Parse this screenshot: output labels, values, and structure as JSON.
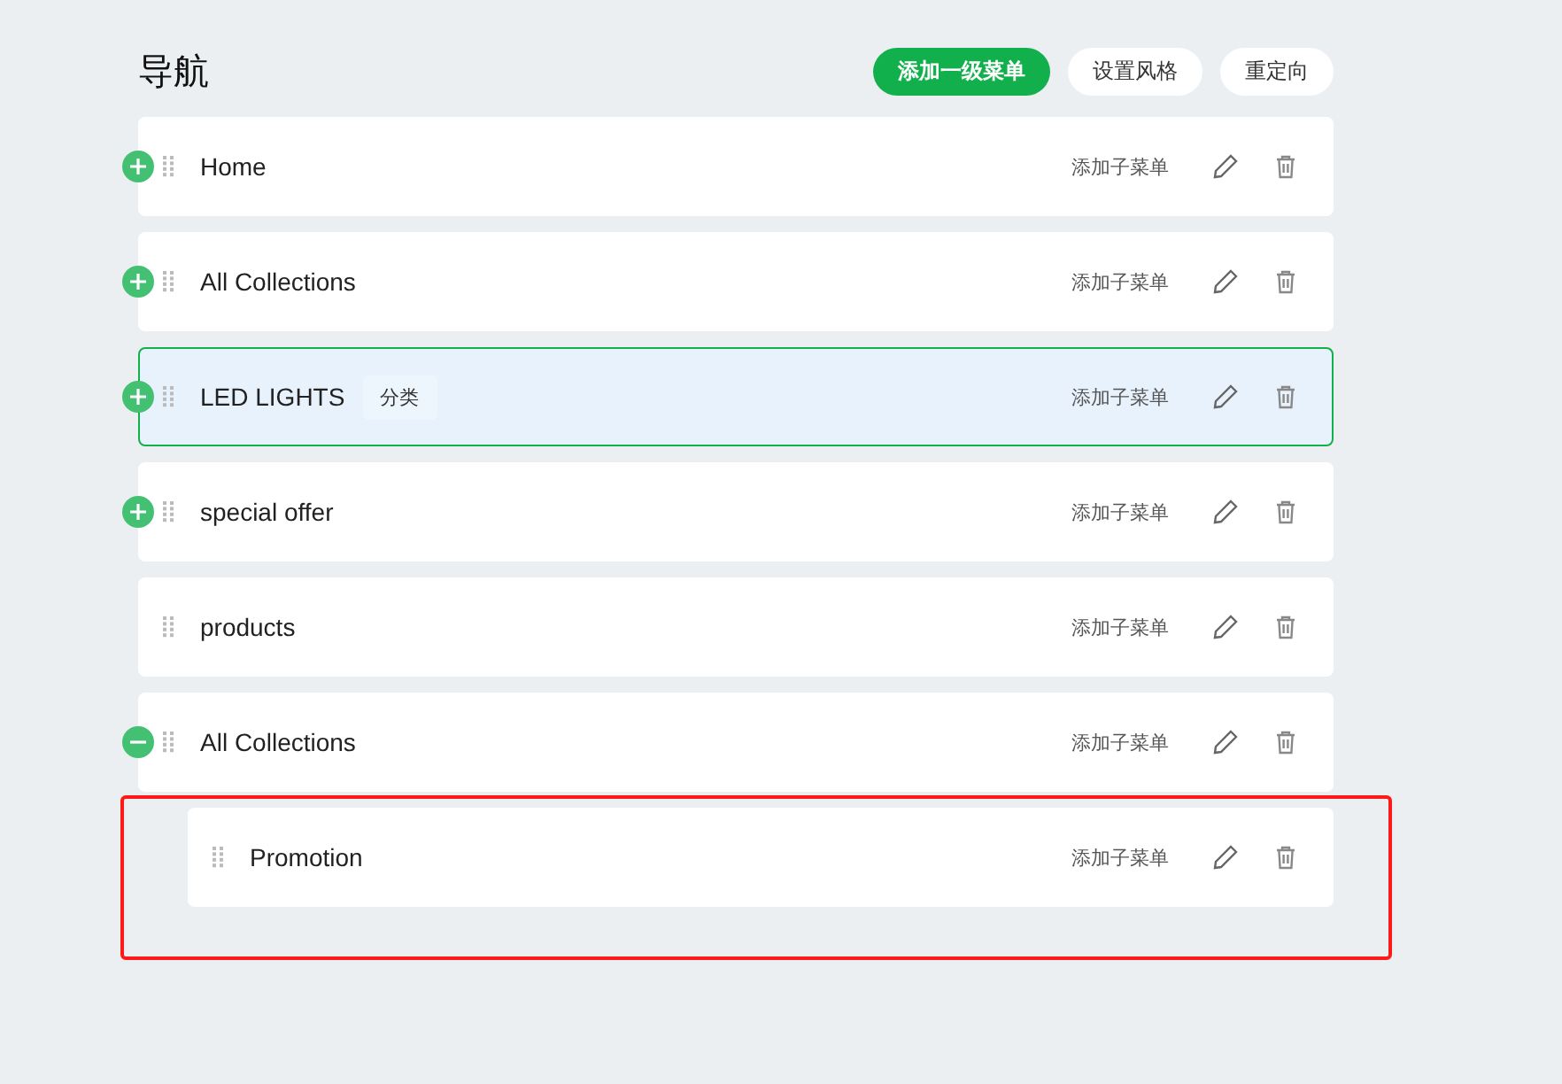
{
  "title": "导航",
  "actions": [
    {
      "label": "添加一级菜单",
      "kind": "primary"
    },
    {
      "label": "设置风格",
      "kind": "plain"
    },
    {
      "label": "重定向",
      "kind": "plain"
    }
  ],
  "items": [
    {
      "label": "Home",
      "expanded": false,
      "selected": false,
      "add_label": "添加子菜单"
    },
    {
      "label": "All Collections",
      "expanded": false,
      "selected": false,
      "add_label": "添加子菜单"
    },
    {
      "label": "LED LIGHTS",
      "tag": "分类",
      "expanded": false,
      "selected": true,
      "add_label": "添加子菜单"
    },
    {
      "label": "special offer",
      "expanded": false,
      "selected": false,
      "add_label": "添加子菜单"
    },
    {
      "label": "products",
      "selected": false,
      "add_label": "添加子菜单"
    },
    {
      "label": "All Collections",
      "expanded": true,
      "selected": false,
      "add_label": "添加子菜单",
      "children_marked": true,
      "children": [
        {
          "label": "Promotion",
          "selected": false,
          "add_label": "添加子菜单"
        }
      ]
    }
  ]
}
